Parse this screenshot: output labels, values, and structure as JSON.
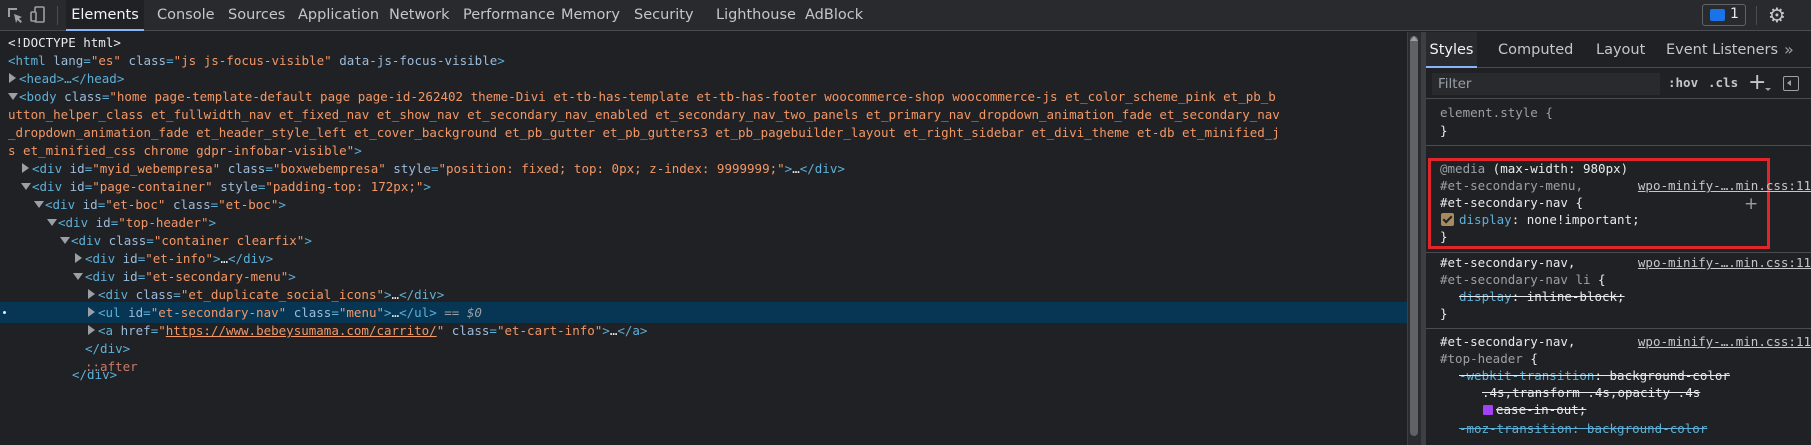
{
  "toolbar": {
    "tabs": [
      "Elements",
      "Console",
      "Sources",
      "Application",
      "Network",
      "Performance",
      "Memory",
      "Security",
      "Lighthouse",
      "AdBlock"
    ],
    "active_tab": "Elements",
    "issues_count": "1",
    "accent_color": "#8ab4f8"
  },
  "dom": {
    "doctype": "<!DOCTYPE html>",
    "html_tag": "html",
    "html_lang_attr": "lang",
    "html_lang_val": "\"es\"",
    "html_class_attr": "class",
    "html_class_val": "\"js js-focus-visible\"",
    "html_data_attr": "data-js-focus-visible",
    "head_text": "<head>…</head>",
    "body_class_part1": "\"home page-template-default page page-id-262402 theme-Divi et-tb-has-template et-tb-has-footer woocommerce-shop woocommerce-js et_color_scheme_pink et_pb_b",
    "body_class_part2": "utton_helper_class et_fullwidth_nav et_fixed_nav et_show_nav et_secondary_nav_enabled et_secondary_nav_two_panels et_primary_nav_dropdown_animation_fade et_secondary_nav",
    "body_class_part3": "_dropdown_animation_fade et_header_style_left et_cover_background et_pb_gutter et_pb_gutters3 et_pb_pagebuilder_layout et_right_sidebar et_divi_theme et-db et_minified_j",
    "body_class_part4": "s et_minified_css chrome gdpr-infobar-visible\"",
    "myid_id": "\"myid_webempresa\"",
    "myid_class": "\"boxwebempresa\"",
    "myid_style": "\"position: fixed; top: 0px; z-index: 9999999;\"",
    "page_container_id": "\"page-container\"",
    "page_container_style": "\"padding-top: 172px;\"",
    "etboc_id": "\"et-boc\"",
    "etboc_class": "\"et-boc\"",
    "top_header_id": "\"top-header\"",
    "container_class": "\"container clearfix\"",
    "etinfo_id": "\"et-info\"",
    "secondary_menu_id": "\"et-secondary-menu\"",
    "dup_social_class": "\"et_duplicate_social_icons\"",
    "ul_id": "\"et-secondary-nav\"",
    "ul_class": "\"menu\"",
    "selected_marker": "== $0",
    "a_href": "https://www.bebeysumama.com/carrito/",
    "a_class": "\"et-cart-info\"",
    "close_div": "</div>",
    "after_pseudo": "::after",
    "close_div_partial": "</div>"
  },
  "styles": {
    "tabs": [
      "Styles",
      "Computed",
      "Layout",
      "Event Listeners"
    ],
    "active_tab": "Styles",
    "filter_placeholder": "Filter",
    "hov_label": ":hov",
    "cls_label": ".cls",
    "element_style": "element.style {",
    "close_brace": "}",
    "media_at": "@media",
    "media_query": " (max-width: 980px)",
    "rule1_sel1": "#et-secondary-menu,",
    "rule1_sel2": "#et-secondary-nav {",
    "rule1_prop": "display",
    "rule1_val": ": none!important;",
    "rule_source": "wpo-minify-….min.css:11",
    "rule2_sel1": "#et-secondary-nav,",
    "rule2_sel2": "#et-secondary-nav li",
    "rule2_sel2_brace": " {",
    "rule2_prop": "display",
    "rule2_val": ": inline-block;",
    "rule3_sel1": "#et-secondary-nav,",
    "rule3_sel2": "#top-header",
    "rule3_prop": "-webkit-transition",
    "rule3_val": ": background-color",
    "rule3_val2": ".4s,transform .4s,opacity .4s",
    "rule3_val3": "ease-in-out;",
    "rule3_next": "-moz-transition: background-color",
    "highlight_color": "#e0262b"
  }
}
